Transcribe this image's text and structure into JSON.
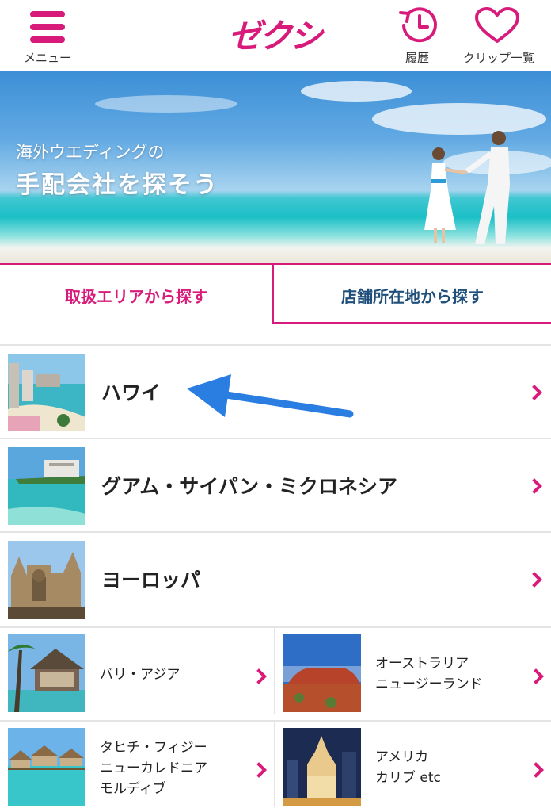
{
  "header": {
    "menu_label": "メニュー",
    "logo_text": "ゼクシィ",
    "history_label": "履歴",
    "clip_label": "クリップ一覧"
  },
  "hero": {
    "subtitle": "海外ウエディングの",
    "title": "手配会社を探そう"
  },
  "tabs": [
    {
      "label": "取扱エリアから探す",
      "active": true
    },
    {
      "label": "店舗所在地から探す",
      "active": false
    }
  ],
  "areas": [
    {
      "label": "ハワイ",
      "image": "hawaii-beach"
    },
    {
      "label": "グアム・サイパン・ミクロネシア",
      "image": "guam-hotel-beach"
    },
    {
      "label": "ヨーロッパ",
      "image": "cathedral"
    }
  ],
  "grid": [
    {
      "lines": [
        "バリ・アジア"
      ],
      "image": "bali-pavilion"
    },
    {
      "lines": [
        "オーストラリア",
        "ニュージーランド"
      ],
      "image": "uluru"
    },
    {
      "lines": [
        "タヒチ・フィジー",
        "ニューカレドニア",
        "モルディブ"
      ],
      "image": "overwater-bungalows"
    },
    {
      "lines": [
        "アメリカ",
        "カリブ etc"
      ],
      "image": "city-night"
    }
  ],
  "colors": {
    "accent": "#d81b7a",
    "tab_inactive_text": "#1f4f7a",
    "annotation_arrow": "#2a7de1"
  }
}
